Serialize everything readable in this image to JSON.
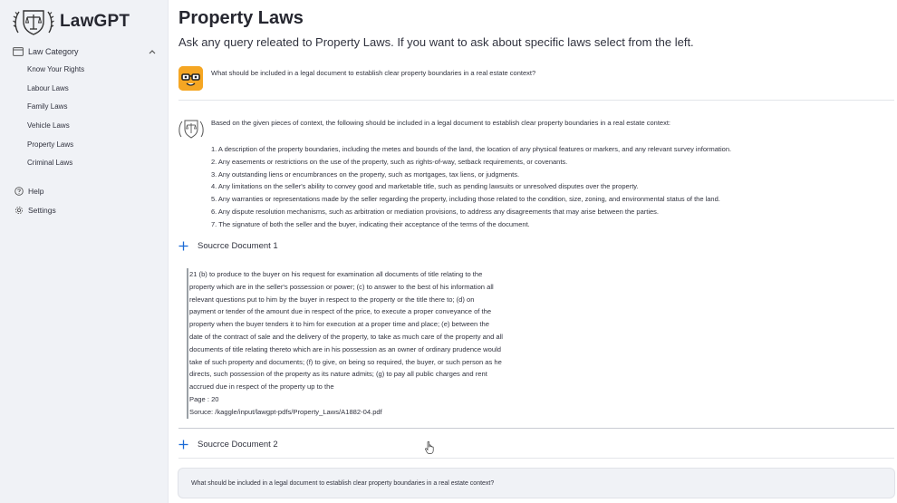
{
  "sidebar": {
    "brand": "LawGPT",
    "category_header": "Law Category",
    "categories": [
      "Know Your Rights",
      "Labour Laws",
      "Family Laws",
      "Vehicle Laws",
      "Property Laws",
      "Criminal Laws"
    ],
    "help_label": "Help",
    "settings_label": "Settings"
  },
  "main": {
    "title": "Property Laws",
    "subtitle": "Ask any query releated to Property Laws. If you want to ask about specific laws select from the left.",
    "user_question": "What should be included in a legal document to establish clear property boundaries in a real estate context?",
    "answer_intro": "Based on the given pieces of context, the following should be included in a legal document to establish clear property boundaries in a real estate context:",
    "answer_items": [
      "1. A description of the property boundaries, including the metes and bounds of the land, the location of any physical features or markers, and any relevant survey information.",
      "2. Any easements or restrictions on the use of the property, such as rights-of-way, setback requirements, or covenants.",
      "3. Any outstanding liens or encumbrances on the property, such as mortgages, tax liens, or judgments.",
      "4. Any limitations on the seller's ability to convey good and marketable title, such as pending lawsuits or unresolved disputes over the property.",
      "5. Any warranties or representations made by the seller regarding the property, including those related to the condition, size, zoning, and environmental status of the land.",
      "6. Any dispute resolution mechanisms, such as arbitration or mediation provisions, to address any disagreements that may arise between the parties.",
      "7. The signature of both the seller and the buyer, indicating their acceptance of the terms of the document."
    ],
    "source1_label": "Soucrce Document 1",
    "source1_lines": [
      "21 (b) to produce to the buyer on his request for examination all documents of title relating to the",
      "property which are in the seller's possession or power; (c) to answer to the best of his information all",
      "relevant questions put to him by the buyer in respect to the property or the title there to; (d) on",
      "payment or tender of the amount due in respect of the price, to execute a proper conveyance of the",
      "property when the buyer tenders it to him for execution at a proper time and place; (e) between the",
      "date of the contract of sale and the delivery of the property, to take as much care of the property and all",
      "documents of title relating thereto which are in his possession as an owner of ordinary prudence would",
      "take of such property and documents; (f) to give, on being so required, the buyer, or such person as he",
      "directs, such possession of the property as its nature admits; (g) to pay all public charges and rent",
      "accrued due in respect of the property up to the",
      "Page : 20",
      "Soruce: /kaggle/input/lawgpt-pdfs/Property_Laws/A1882-04.pdf"
    ],
    "source2_label": "Soucrce Document 2",
    "chat_input_value": "What should be included in a legal document to establish clear property boundaries in a real estate context?"
  },
  "colors": {
    "sidebar_bg": "#f0f2f6",
    "user_avatar": "#f5a623",
    "accent_plus": "#1c6bd6"
  }
}
